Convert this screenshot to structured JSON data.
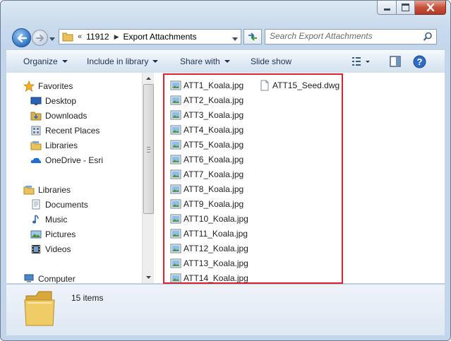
{
  "address": {
    "overflow": "«",
    "crumbs": [
      "11912",
      "Export Attachments"
    ]
  },
  "search": {
    "placeholder": "Search Export Attachments"
  },
  "toolbar": {
    "organize": "Organize",
    "include_in_library": "Include in library",
    "share_with": "Share with",
    "slide_show": "Slide show"
  },
  "nav": {
    "favorites": "Favorites",
    "desktop": "Desktop",
    "downloads": "Downloads",
    "recent_places": "Recent Places",
    "fav_libraries": "Libraries",
    "onedrive": "OneDrive - Esri",
    "libraries": "Libraries",
    "documents": "Documents",
    "music": "Music",
    "pictures": "Pictures",
    "videos": "Videos",
    "computer": "Computer"
  },
  "files": [
    {
      "name": "ATT1_Koala.jpg",
      "icon": "image-file-icon"
    },
    {
      "name": "ATT2_Koala.jpg",
      "icon": "image-file-icon"
    },
    {
      "name": "ATT3_Koala.jpg",
      "icon": "image-file-icon"
    },
    {
      "name": "ATT4_Koala.jpg",
      "icon": "image-file-icon"
    },
    {
      "name": "ATT5_Koala.jpg",
      "icon": "image-file-icon"
    },
    {
      "name": "ATT6_Koala.jpg",
      "icon": "image-file-icon"
    },
    {
      "name": "ATT7_Koala.jpg",
      "icon": "image-file-icon"
    },
    {
      "name": "ATT8_Koala.jpg",
      "icon": "image-file-icon"
    },
    {
      "name": "ATT9_Koala.jpg",
      "icon": "image-file-icon"
    },
    {
      "name": "ATT10_Koala.jpg",
      "icon": "image-file-icon"
    },
    {
      "name": "ATT11_Koala.jpg",
      "icon": "image-file-icon"
    },
    {
      "name": "ATT12_Koala.jpg",
      "icon": "image-file-icon"
    },
    {
      "name": "ATT13_Koala.jpg",
      "icon": "image-file-icon"
    },
    {
      "name": "ATT14_Koala.jpg",
      "icon": "image-file-icon"
    },
    {
      "name": "ATT15_Seed.dwg",
      "icon": "generic-file-icon"
    }
  ],
  "details": {
    "item_count": "15 items"
  },
  "colors": {
    "highlight_border": "#e02030",
    "chrome": "#c9dbee"
  }
}
